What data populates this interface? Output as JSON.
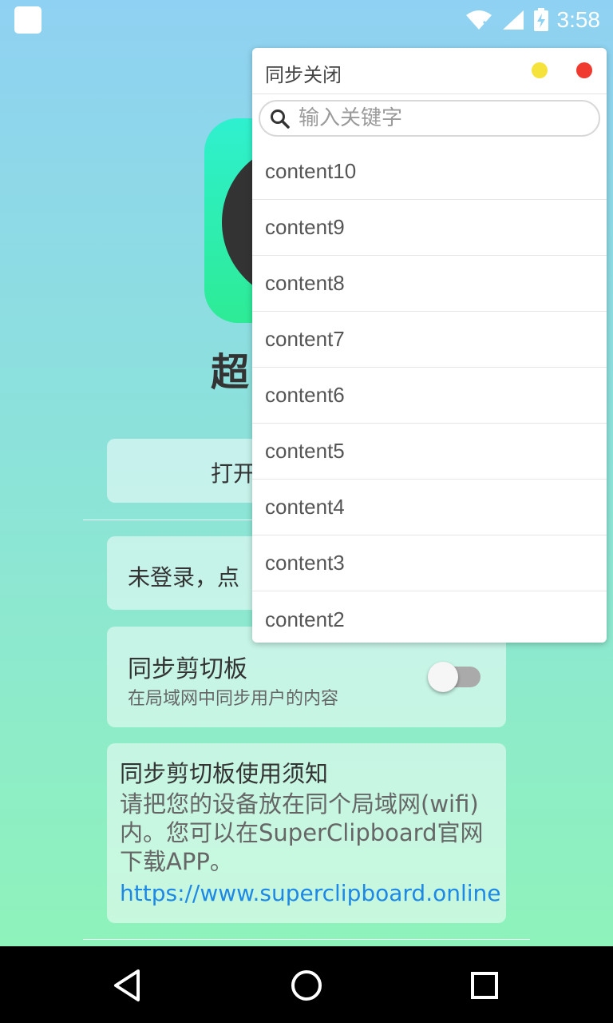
{
  "status_bar": {
    "time": "3:58"
  },
  "app": {
    "name_visible": "超",
    "open_button_label": "打开",
    "login_text": "未登录，点",
    "sync_title": "同步剪切板",
    "sync_subtitle": "在局域网中同步用户的内容",
    "sync_enabled": false,
    "notice_title": "同步剪切板使用须知",
    "notice_body": "请把您的设备放在同个局域网(wifi)内。您可以在SuperClipboard官网下载APP。",
    "notice_link": "https://www.superclipboard.online"
  },
  "popup": {
    "title": "同步关闭",
    "search_placeholder": "输入关键字",
    "minimize_color": "#f5e33b",
    "close_color": "#f0392f",
    "items": [
      "content10",
      "content9",
      "content8",
      "content7",
      "content6",
      "content5",
      "content4",
      "content3",
      "content2"
    ]
  },
  "icons": {
    "status": [
      "wifi-icon",
      "signal-icon",
      "battery-charging-icon"
    ],
    "nav": [
      "back-icon",
      "home-icon",
      "recent-apps-icon"
    ],
    "search": "search-icon"
  }
}
